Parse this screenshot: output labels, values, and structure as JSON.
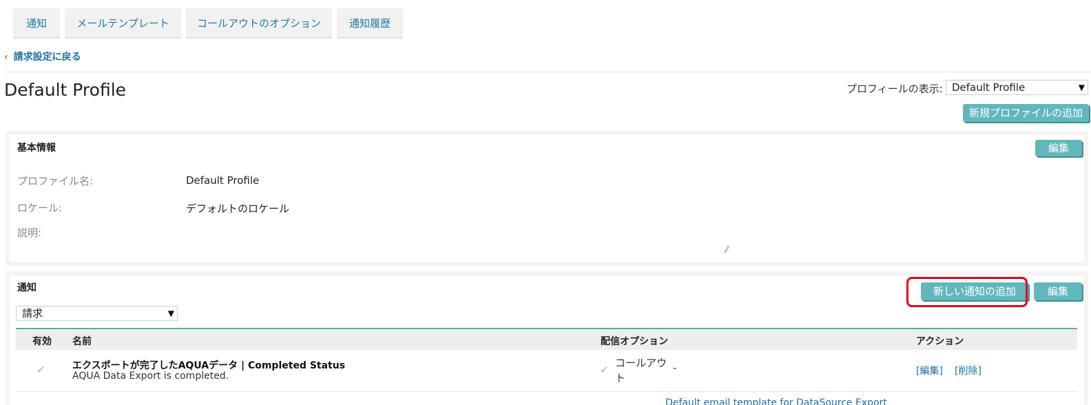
{
  "tabs": [
    {
      "label": "通知"
    },
    {
      "label": "メールテンプレート"
    },
    {
      "label": "コールアウトのオプション"
    },
    {
      "label": "通知履歴"
    }
  ],
  "back_link": {
    "chevron": "‹",
    "label": "請求設定に戻る"
  },
  "page_title": "Default Profile",
  "profile_selector": {
    "label": "プロフィールの表示:",
    "selected": "Default Profile",
    "arrow": "▼"
  },
  "new_profile_button": "新規プロファイルの追加",
  "basic_info": {
    "title": "基本情報",
    "edit_label": "編集",
    "fields": [
      {
        "label": "プロファイル名:",
        "value": "Default Profile"
      },
      {
        "label": "ロケール:",
        "value": "デフォルトのロケール"
      },
      {
        "label": "説明:",
        "value": ""
      }
    ],
    "resize_glyph": "⁄⁄"
  },
  "notifications": {
    "title": "通知",
    "add_label": "新しい通知の追加",
    "edit_label": "編集",
    "category_selected": "請求",
    "category_arrow": "▼",
    "columns": {
      "enabled": "有効",
      "name": "名前",
      "delivery": "配信オプション",
      "actions": "アクション"
    },
    "rows": [
      {
        "enabled_glyph": "✔",
        "name": "エクスポートが完了したAQUAデータ | Completed Status",
        "description": "AQUA Data Export is completed.",
        "delivery_glyph": "✔",
        "delivery_text": "コールアウト",
        "delivery_extra": "-",
        "edit": "[編集]",
        "delete": "[削除]"
      }
    ],
    "partial_next_link": "Default email template for DataSource Export"
  },
  "colors": {
    "accent": "#62b7bd",
    "link": "#1f6fa3",
    "highlight": "#e3001b"
  }
}
